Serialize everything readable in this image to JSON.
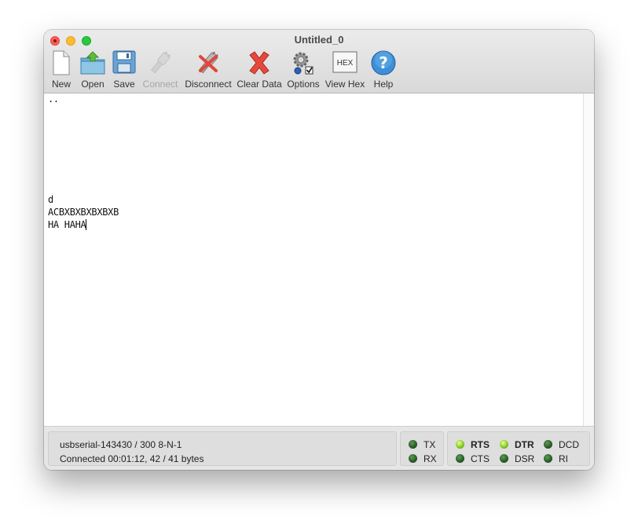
{
  "window": {
    "title": "Untitled_0"
  },
  "toolbar": [
    {
      "label": "New",
      "icon": "new-document-icon",
      "enabled": true
    },
    {
      "label": "Open",
      "icon": "open-folder-icon",
      "enabled": true
    },
    {
      "label": "Save",
      "icon": "save-floppy-icon",
      "enabled": true
    },
    {
      "label": "Connect",
      "icon": "connect-plug-icon",
      "enabled": false
    },
    {
      "label": "Disconnect",
      "icon": "disconnect-plug-icon",
      "enabled": true
    },
    {
      "label": "Clear Data",
      "icon": "clear-x-icon",
      "enabled": true
    },
    {
      "label": "Options",
      "icon": "options-gear-icon",
      "enabled": true
    },
    {
      "label": "View Hex",
      "icon": "hex-icon",
      "enabled": true
    },
    {
      "label": "Help",
      "icon": "help-question-icon",
      "enabled": true
    }
  ],
  "hex_icon_text": "HEX",
  "terminal": {
    "lines": [
      "..",
      "d",
      "ACBXBXBXBXBXB",
      "HA HAHA"
    ]
  },
  "status": {
    "port": "usbserial-143430 / 300 8-N-1",
    "connection": "Connected 00:01:12, 42 / 41 bytes"
  },
  "signals": {
    "tx": {
      "label": "TX",
      "on": false
    },
    "rx": {
      "label": "RX",
      "on": false
    },
    "rts": {
      "label": "RTS",
      "on": true
    },
    "cts": {
      "label": "CTS",
      "on": false
    },
    "dtr": {
      "label": "DTR",
      "on": true
    },
    "dsr": {
      "label": "DSR",
      "on": false
    },
    "dcd": {
      "label": "DCD",
      "on": false
    },
    "ri": {
      "label": "RI",
      "on": false
    }
  },
  "colors": {
    "led_on": "#8fd21f",
    "led_off": "#2f6a2a",
    "close": "#fe5f57",
    "minimize": "#febc2e",
    "maximize": "#28c840"
  }
}
